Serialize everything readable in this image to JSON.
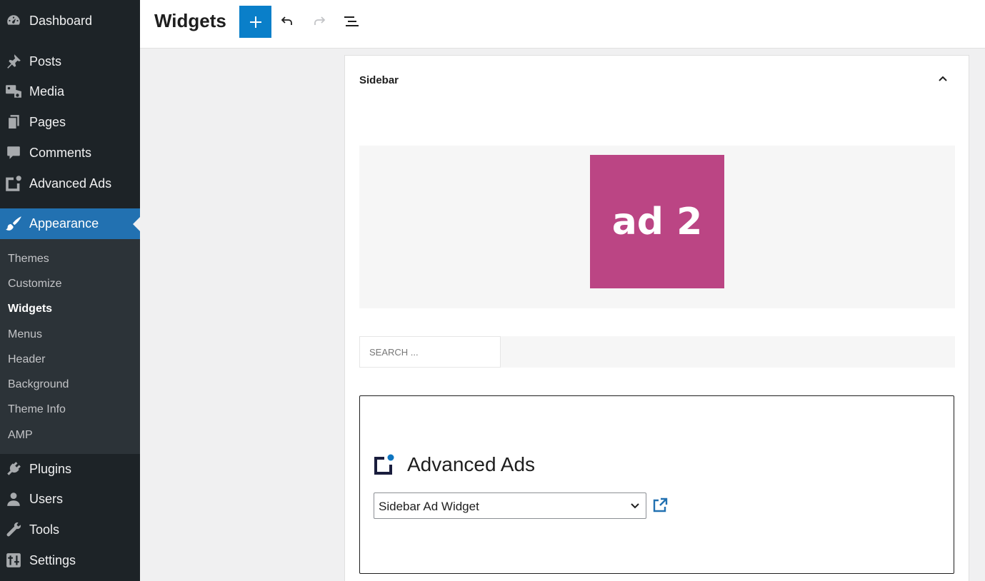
{
  "sidebar": {
    "items": [
      {
        "label": "Dashboard",
        "icon": "dashboard-icon"
      },
      {
        "label": "Posts",
        "icon": "pin-icon"
      },
      {
        "label": "Media",
        "icon": "media-icon"
      },
      {
        "label": "Pages",
        "icon": "pages-icon"
      },
      {
        "label": "Comments",
        "icon": "comment-icon"
      },
      {
        "label": "Advanced Ads",
        "icon": "advanced-ads-icon"
      },
      {
        "label": "Appearance",
        "icon": "paintbrush-icon"
      },
      {
        "label": "Plugins",
        "icon": "plugin-icon"
      },
      {
        "label": "Users",
        "icon": "user-icon"
      },
      {
        "label": "Tools",
        "icon": "wrench-icon"
      },
      {
        "label": "Settings",
        "icon": "settings-icon"
      }
    ],
    "submenu": [
      "Themes",
      "Customize",
      "Widgets",
      "Menus",
      "Header",
      "Background",
      "Theme Info",
      "AMP"
    ]
  },
  "header": {
    "title": "Widgets"
  },
  "panel": {
    "title": "Sidebar",
    "ad_text": "ad 2",
    "search_placeholder": "SEARCH ...",
    "widget_title": "Advanced Ads",
    "widget_select": "Sidebar Ad Widget"
  },
  "colors": {
    "sidebar_bg": "#1d2327",
    "active_bg": "#2271b1",
    "accent": "#0a7fc9",
    "ad_bg": "#bb4584"
  }
}
